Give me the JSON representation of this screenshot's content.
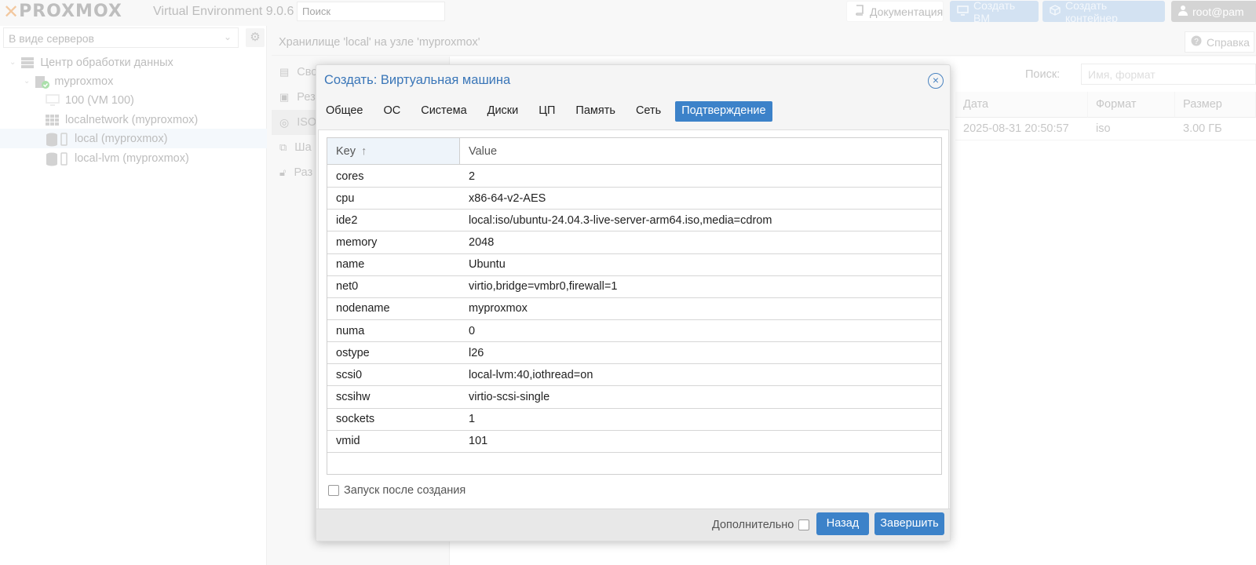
{
  "topbar": {
    "logo_x": "✕",
    "logo_text": "PROXMOX",
    "version": "Virtual Environment 9.0.6",
    "search_placeholder": "Поиск",
    "docs_label": "Документация",
    "create_vm_label": "Создать ВМ",
    "create_ct_label": "Создать контейнер",
    "user_label": "root@pam"
  },
  "sidebar": {
    "view_select": "В виде серверов",
    "tree": [
      {
        "label": "Центр обработки данных"
      },
      {
        "label": "myproxmox"
      },
      {
        "label": "100 (VM 100)"
      },
      {
        "label": "localnetwork (myproxmox)"
      },
      {
        "label": "local (myproxmox)"
      },
      {
        "label": "local-lvm (myproxmox)"
      }
    ]
  },
  "center": {
    "header_title": "Хранилище 'local' на узле 'myproxmox'",
    "help_label": "Справка",
    "subnav": [
      {
        "label": "Сво"
      },
      {
        "label": "Рез"
      },
      {
        "label": "ISO"
      },
      {
        "label": "Ша"
      },
      {
        "label": "Раз"
      }
    ],
    "search_label": "Поиск:",
    "search_placeholder": "Имя, формат",
    "columns": [
      "Дата",
      "Формат",
      "Размер"
    ],
    "row": {
      "date": "2025-08-31 20:50:57",
      "format": "iso",
      "size": "3.00 ГБ"
    }
  },
  "dialog": {
    "title": "Создать: Виртуальная машина",
    "tabs": [
      "Общее",
      "ОС",
      "Система",
      "Диски",
      "ЦП",
      "Память",
      "Сеть",
      "Подтверждение"
    ],
    "active_tab": "Подтверждение",
    "grid": {
      "key_header": "Key",
      "value_header": "Value",
      "sort_indicator": "↑",
      "rows": [
        {
          "key": "cores",
          "value": "2"
        },
        {
          "key": "cpu",
          "value": "x86-64-v2-AES"
        },
        {
          "key": "ide2",
          "value": "local:iso/ubuntu-24.04.3-live-server-arm64.iso,media=cdrom"
        },
        {
          "key": "memory",
          "value": "2048"
        },
        {
          "key": "name",
          "value": "Ubuntu"
        },
        {
          "key": "net0",
          "value": "virtio,bridge=vmbr0,firewall=1"
        },
        {
          "key": "nodename",
          "value": "myproxmox"
        },
        {
          "key": "numa",
          "value": "0"
        },
        {
          "key": "ostype",
          "value": "l26"
        },
        {
          "key": "scsi0",
          "value": "local-lvm:40,iothread=on"
        },
        {
          "key": "scsihw",
          "value": "virtio-scsi-single"
        },
        {
          "key": "sockets",
          "value": "1"
        },
        {
          "key": "vmid",
          "value": "101"
        }
      ]
    },
    "start_after_create_label": "Запуск после создания",
    "advanced_label": "Дополнительно",
    "back_label": "Назад",
    "finish_label": "Завершить"
  },
  "colors": {
    "accent": "#3c82c9",
    "title": "#3a76b8",
    "logo_orange": "#e57000"
  }
}
